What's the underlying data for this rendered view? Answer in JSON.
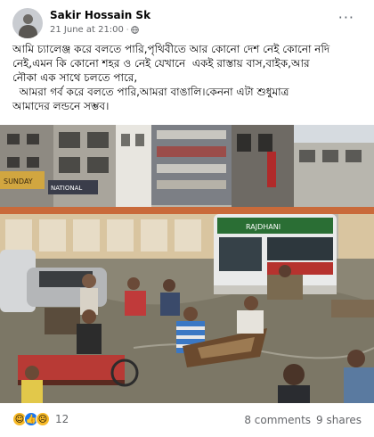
{
  "post": {
    "author": "Sakir Hossain Sk",
    "date": "21 June at 21:00",
    "separator": "·",
    "text_lines": [
      "আমি চ্যালেঞ্জ করে বলতে পারি,পৃথিবীতে আর কোনো দেশ নেই কোনো নদি",
      "নেই,এমন কি কোনো শহর ও নেই যেখানে  একই রাস্তায় বাস,বাইক,আর",
      "নৌকা এক সাথে চলতে পারে,",
      "  আমরা গর্ব করে বলতে পারি,আমরা বাঙালি।কেননা এটা শুধুমাত্র",
      "আমাদের লন্ডনে সম্ভব।"
    ]
  },
  "photo": {
    "building_signs": [
      "SUNDAY",
      "NATIONAL"
    ],
    "bus_header": "RAJDHANI"
  },
  "reactions": {
    "icons": [
      "haha-icon",
      "like-icon",
      "sad-icon"
    ],
    "count": "12",
    "comments": "8 comments",
    "shares": "9 shares"
  },
  "colors": {
    "meta": "#65676b",
    "like": "#1877f2",
    "emoji": "#f7b928"
  }
}
